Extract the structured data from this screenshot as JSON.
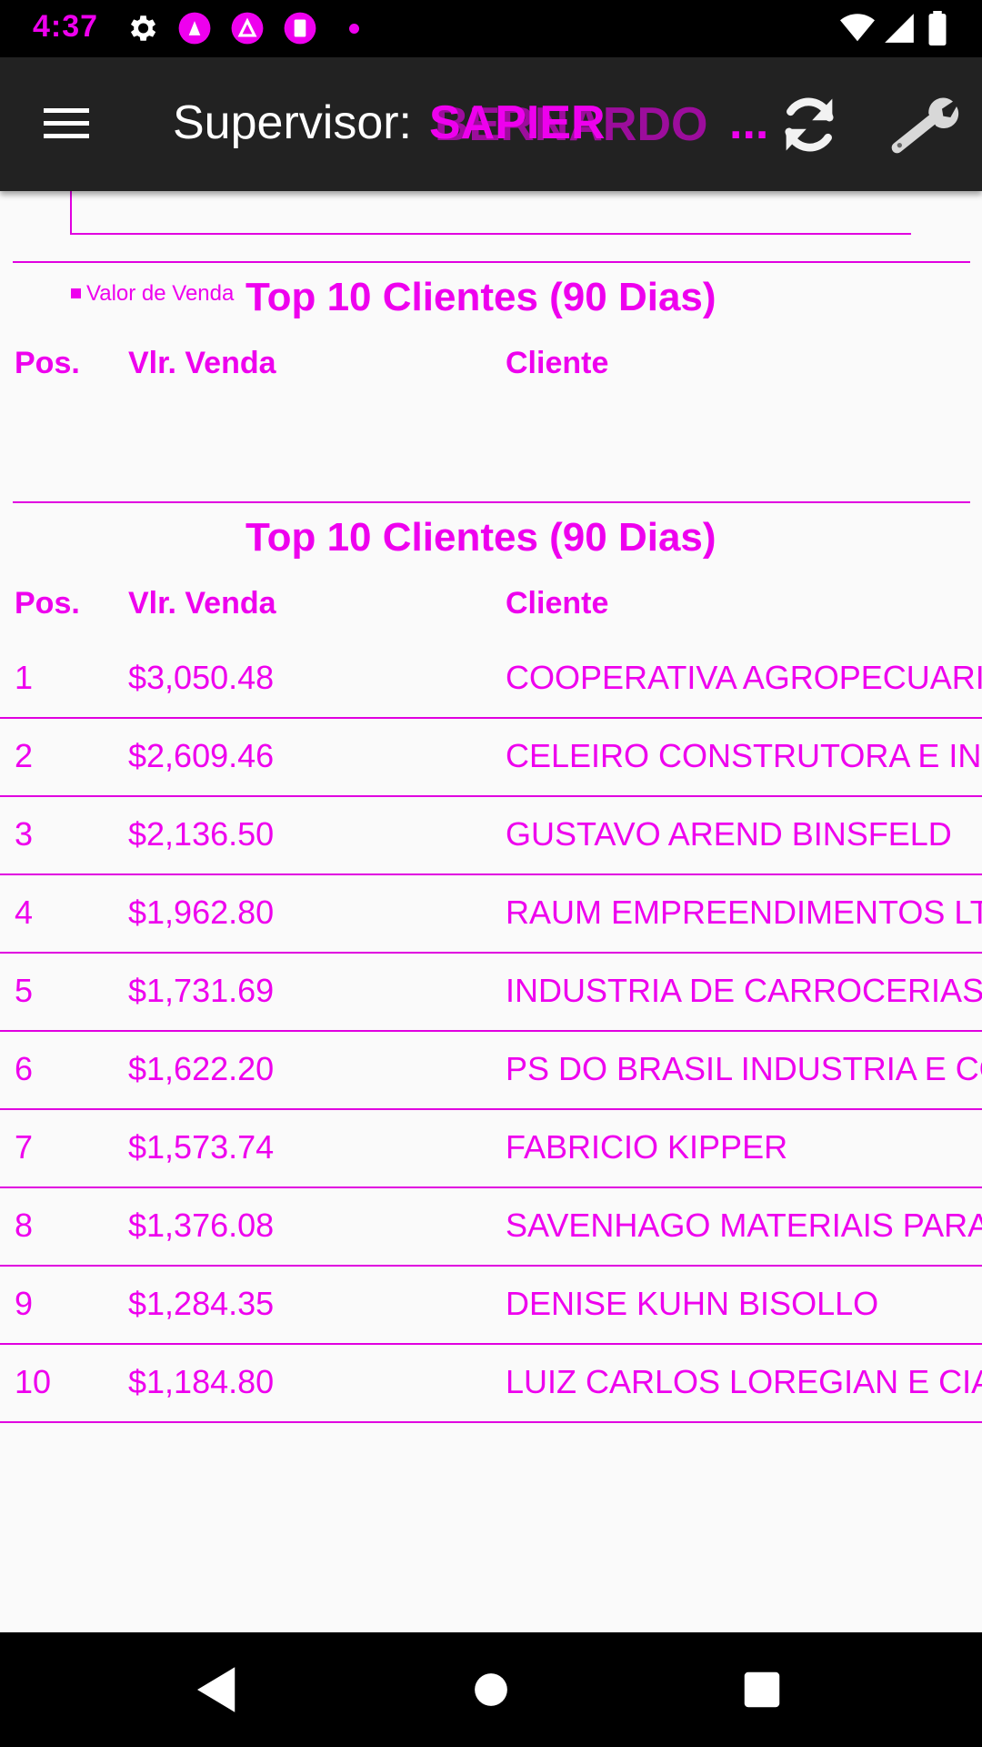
{
  "status_bar": {
    "time": "4:37",
    "icons": [
      "settings-icon",
      "app-notification-icon",
      "app-notification-icon",
      "app-notification-icon",
      "more-notifications-dot"
    ],
    "right_icons": [
      "wifi-icon",
      "signal-icon",
      "battery-icon"
    ]
  },
  "app_bar": {
    "title_prefix": "Supervisor:",
    "title_name_a": "SAPIER",
    "title_name_b": "BERNARDO",
    "title_ellipsis": "...",
    "refresh_icon": "refresh-icon",
    "settings_icon": "wrench-icon"
  },
  "chart": {
    "legend_label": "Valor de Venda",
    "title": "Top 10 Clientes (90 Dias)",
    "columns": [
      "Pos.",
      "Vlr. Venda",
      "Cliente"
    ]
  },
  "table": {
    "title": "Top 10 Clientes (90 Dias)",
    "columns": [
      "Pos.",
      "Vlr. Venda",
      "Cliente"
    ],
    "rows": [
      {
        "pos": "1",
        "value": "$3,050.48",
        "client": "COOPERATIVA AGROPECUARIA"
      },
      {
        "pos": "2",
        "value": "$2,609.46",
        "client": "CELEIRO CONSTRUTORA E INCO"
      },
      {
        "pos": "3",
        "value": "$2,136.50",
        "client": "GUSTAVO AREND BINSFELD"
      },
      {
        "pos": "4",
        "value": "$1,962.80",
        "client": "RAUM EMPREENDIMENTOS LTDA"
      },
      {
        "pos": "5",
        "value": "$1,731.69",
        "client": "INDUSTRIA DE CARROCERIAS D"
      },
      {
        "pos": "6",
        "value": "$1,622.20",
        "client": "PS DO BRASIL INDUSTRIA E COM"
      },
      {
        "pos": "7",
        "value": "$1,573.74",
        "client": "FABRICIO KIPPER"
      },
      {
        "pos": "8",
        "value": "$1,376.08",
        "client": "SAVENHAGO MATERIAIS PARA C"
      },
      {
        "pos": "9",
        "value": "$1,284.35",
        "client": "DENISE KUHN BISOLLO"
      },
      {
        "pos": "10",
        "value": "$1,184.80",
        "client": "LUIZ CARLOS LOREGIAN E CIA L"
      }
    ]
  },
  "nav_bar": {
    "back_icon": "back-icon",
    "home_icon": "home-icon",
    "recents_icon": "recents-icon"
  },
  "colors": {
    "accent": "#ee00ee",
    "app_bar": "#222222",
    "background": "#fafafa"
  }
}
